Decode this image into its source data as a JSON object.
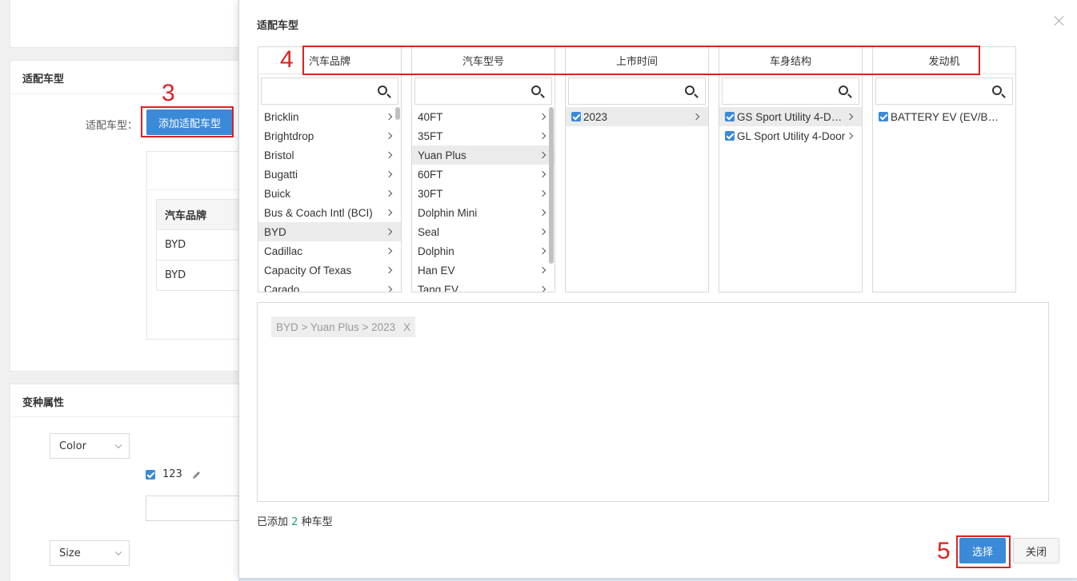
{
  "background": {
    "section_fit": {
      "title": "适配车型",
      "label": "适配车型：",
      "add_button": "添加适配车型"
    },
    "table": {
      "header": "汽车品牌",
      "rows": [
        "BYD",
        "BYD"
      ]
    },
    "section_variant": {
      "title": "变种属性",
      "color_select": "Color",
      "option_label": "123",
      "size_select": "Size"
    }
  },
  "annotations": {
    "a3": "3",
    "a4": "4",
    "a5": "5"
  },
  "modal": {
    "title": "适配车型",
    "columns": [
      {
        "header": "汽车品牌",
        "items": [
          {
            "label": "Bricklin"
          },
          {
            "label": "Brightdrop"
          },
          {
            "label": "Bristol"
          },
          {
            "label": "Bugatti"
          },
          {
            "label": "Buick"
          },
          {
            "label": "Bus & Coach Intl (BCI)"
          },
          {
            "label": "BYD",
            "selected": true
          },
          {
            "label": "Cadillac"
          },
          {
            "label": "Capacity Of Texas"
          },
          {
            "label": "Carado"
          }
        ]
      },
      {
        "header": "汽车型号",
        "items": [
          {
            "label": "40FT"
          },
          {
            "label": "35FT"
          },
          {
            "label": "Yuan Plus",
            "selected": true
          },
          {
            "label": "60FT"
          },
          {
            "label": "30FT"
          },
          {
            "label": "Dolphin Mini"
          },
          {
            "label": "Seal"
          },
          {
            "label": "Dolphin"
          },
          {
            "label": "Han EV"
          },
          {
            "label": "Tang EV"
          }
        ]
      },
      {
        "header": "上市时间",
        "items": [
          {
            "label": "2023",
            "checked": true,
            "selected": true
          }
        ]
      },
      {
        "header": "车身结构",
        "items": [
          {
            "label": "GS Sport Utility 4-D…",
            "checked": true,
            "selected": true
          },
          {
            "label": "GL Sport Utility 4-Door",
            "checked": true
          }
        ]
      },
      {
        "header": "发动机",
        "items": [
          {
            "label": "BATTERY EV (EV/B…",
            "checked": true,
            "no_chevron": true
          }
        ]
      }
    ],
    "selected_tags": [
      {
        "label": "BYD > Yuan Plus > 2023",
        "remove": "X"
      }
    ],
    "added_prefix": "已添加",
    "added_count": "2",
    "added_suffix": "种车型",
    "choose_button": "选择",
    "close_button": "关闭"
  }
}
